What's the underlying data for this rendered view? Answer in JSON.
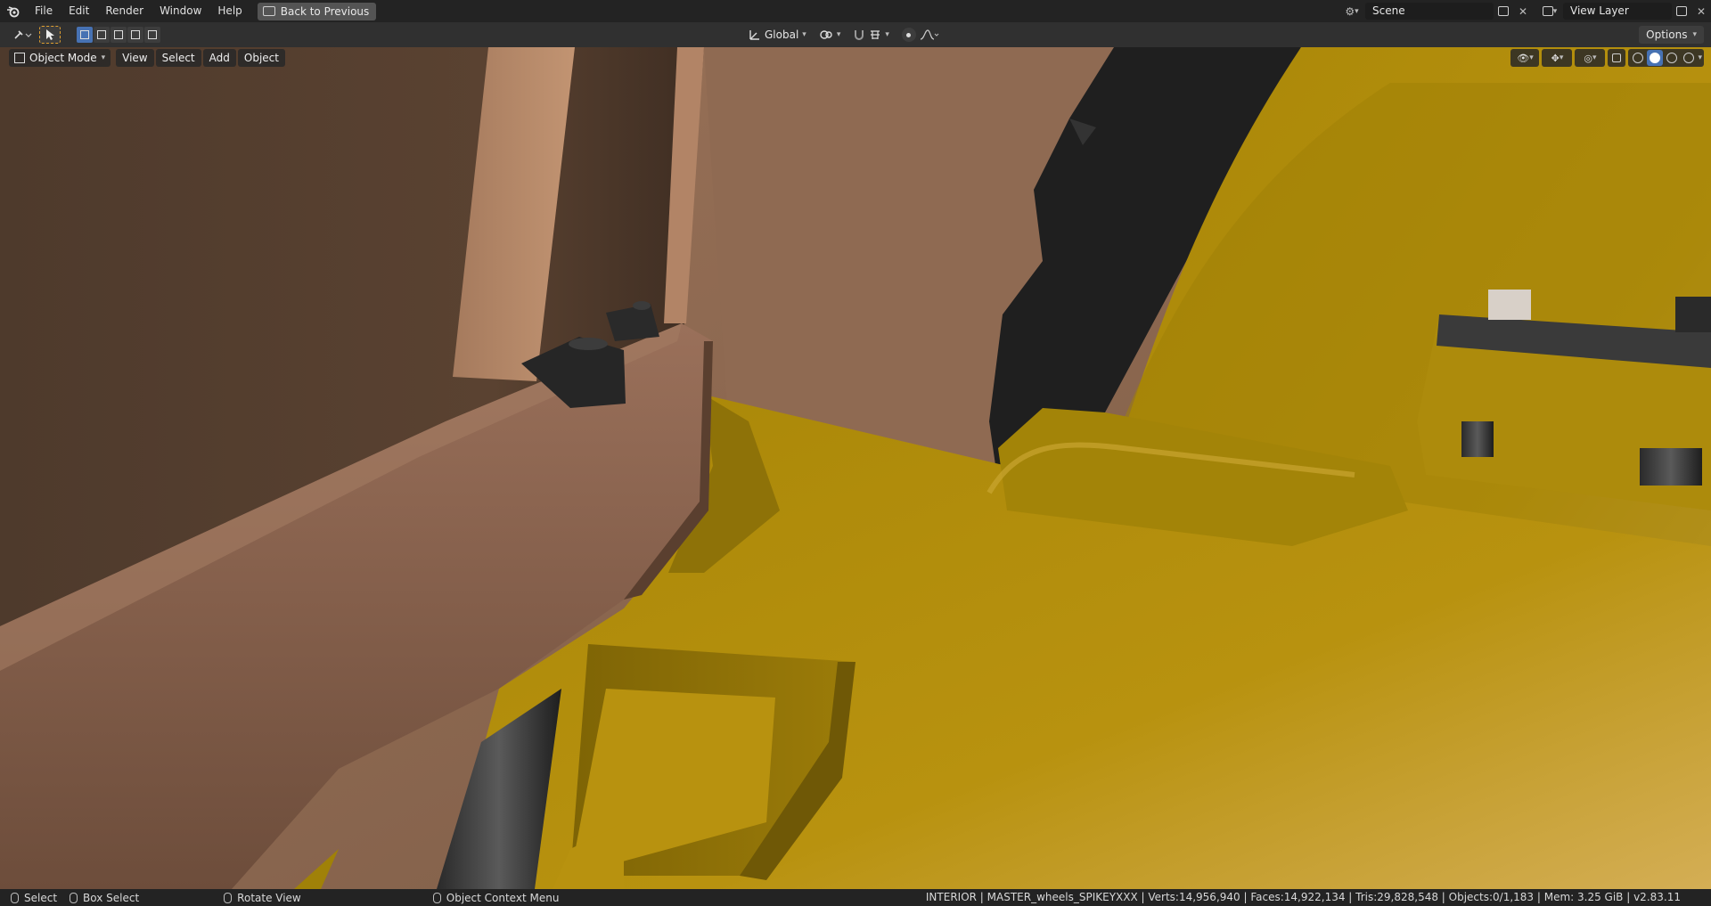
{
  "menubar": {
    "items": [
      "File",
      "Edit",
      "Render",
      "Window",
      "Help"
    ],
    "back_button": "Back to Previous",
    "scene_name": "Scene",
    "view_layer": "View Layer"
  },
  "toolbar": {
    "transform_orientation": "Global",
    "options_label": "Options"
  },
  "viewport": {
    "mode": "Object Mode",
    "menus": [
      "View",
      "Select",
      "Add",
      "Object"
    ],
    "shading_active": "solid"
  },
  "statusbar": {
    "select": "Select",
    "box_select": "Box Select",
    "rotate_view": "Rotate View",
    "context_menu": "Object Context Menu",
    "stats": "INTERIOR | MASTER_wheels_SPIKEYXXX | Verts:14,956,940 | Faces:14,922,134 | Tris:29,828,548 | Objects:0/1,183 | Mem: 3.25 GiB | v2.83.11"
  },
  "colors": {
    "accent": "#4772b3",
    "yellow_body": "#b8920f",
    "brown_wall": "#8a6a52"
  }
}
